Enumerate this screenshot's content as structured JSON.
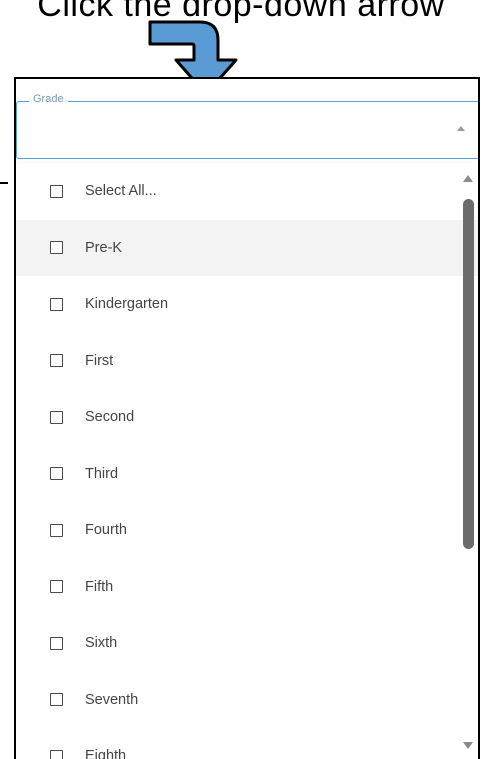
{
  "caption": "Click the drop-down arrow",
  "field": {
    "legend": "Grade"
  },
  "dropdown": {
    "options": [
      "Select All...",
      "Pre-K",
      "Kindergarten",
      "First",
      "Second",
      "Third",
      "Fourth",
      "Fifth",
      "Sixth",
      "Seventh",
      "Eighth"
    ],
    "hovered_index": 1
  },
  "colors": {
    "arrow_fill": "#5b9bd5",
    "field_border": "#5aa0d6",
    "legend_text": "#7a9ab8",
    "hover_bg": "#f3f3f3"
  },
  "icons": {
    "field_caret": "caret-up-icon",
    "scroll_up": "scroll-up-arrow-icon",
    "scroll_down": "scroll-down-arrow-icon",
    "pointer": "curved-arrow-icon"
  }
}
